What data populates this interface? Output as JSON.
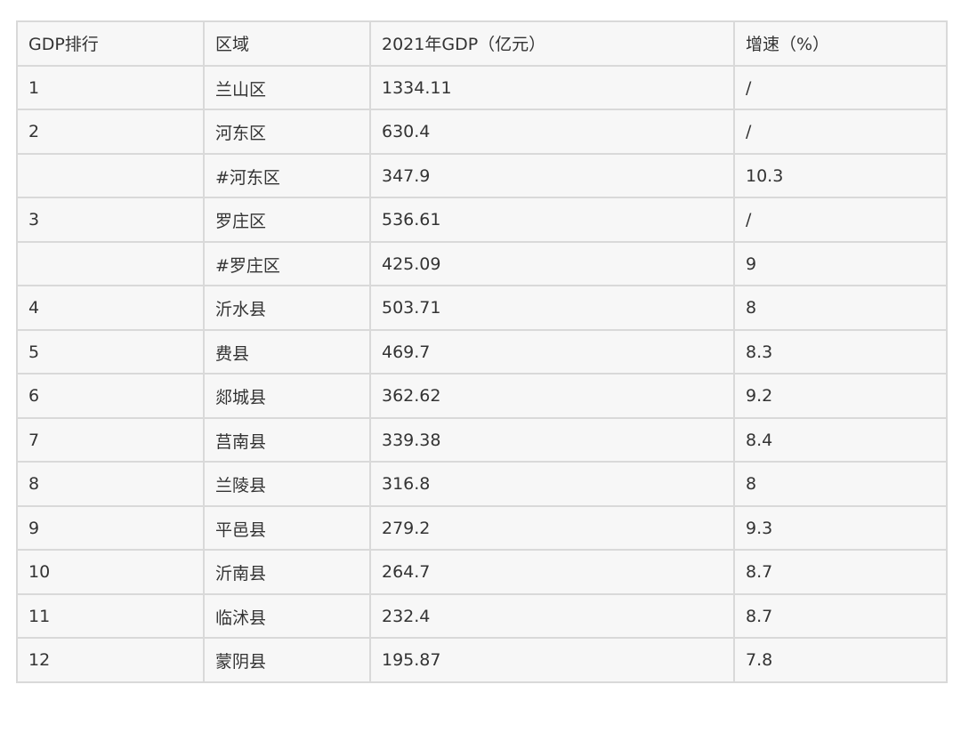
{
  "table": {
    "headers": [
      "GDP排行",
      "区域",
      "2021年GDP（亿元）",
      "增速（%）"
    ],
    "rows": [
      [
        "1",
        "兰山区",
        "1334.11",
        "/"
      ],
      [
        "2",
        "河东区",
        "630.4",
        "/"
      ],
      [
        "",
        "#河东区",
        "347.9",
        "10.3"
      ],
      [
        "3",
        "罗庄区",
        "536.61",
        "/"
      ],
      [
        "",
        "#罗庄区",
        "425.09",
        "9"
      ],
      [
        "4",
        "沂水县",
        "503.71",
        "8"
      ],
      [
        "5",
        "费县",
        "469.7",
        "8.3"
      ],
      [
        "6",
        "郯城县",
        "362.62",
        "9.2"
      ],
      [
        "7",
        "莒南县",
        "339.38",
        "8.4"
      ],
      [
        "8",
        "兰陵县",
        "316.8",
        "8"
      ],
      [
        "9",
        "平邑县",
        "279.2",
        "9.3"
      ],
      [
        "10",
        "沂南县",
        "264.7",
        "8.7"
      ],
      [
        "11",
        "临沭县",
        "232.4",
        "8.7"
      ],
      [
        "12",
        "蒙阴县",
        "195.87",
        "7.8"
      ]
    ]
  }
}
